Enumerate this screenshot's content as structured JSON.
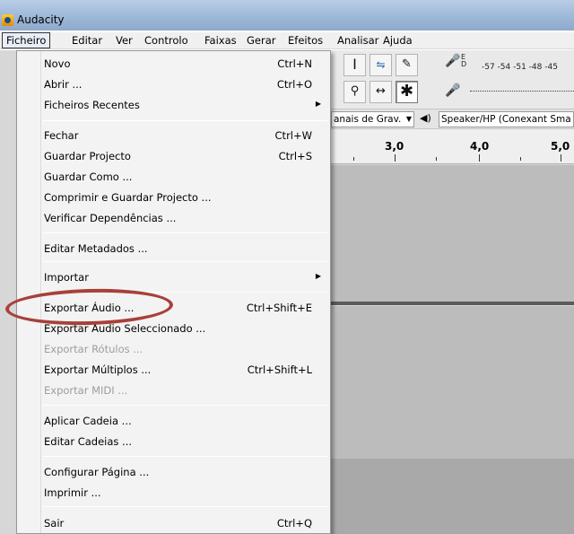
{
  "window": {
    "title": "Audacity"
  },
  "menubar": {
    "items": [
      {
        "name": "menu-ficheiro",
        "label": "Ficheiro",
        "active": true
      },
      {
        "name": "menu-editar",
        "label": "Editar"
      },
      {
        "name": "menu-ver",
        "label": "Ver"
      },
      {
        "name": "menu-controlo",
        "label": "Controlo"
      },
      {
        "name": "menu-faixas",
        "label": "Faixas"
      },
      {
        "name": "menu-gerar",
        "label": "Gerar"
      },
      {
        "name": "menu-efeitos",
        "label": "Efeitos"
      },
      {
        "name": "menu-analisar",
        "label": "Analisar"
      },
      {
        "name": "menu-ajuda",
        "label": "Ajuda"
      }
    ]
  },
  "file_menu": {
    "items": [
      {
        "label": "Novo",
        "shortcut": "Ctrl+N"
      },
      {
        "label": "Abrir ...",
        "shortcut": "Ctrl+O"
      },
      {
        "label": "Ficheiros Recentes",
        "submenu": true
      },
      {
        "separator": true
      },
      {
        "label": "Fechar",
        "shortcut": "Ctrl+W"
      },
      {
        "label": "Guardar Projecto",
        "shortcut": "Ctrl+S"
      },
      {
        "label": "Guardar Como ..."
      },
      {
        "label": "Comprimir e Guardar Projecto ..."
      },
      {
        "label": "Verificar Dependências ..."
      },
      {
        "separator": true
      },
      {
        "label": "Editar Metadados ..."
      },
      {
        "separator": true
      },
      {
        "label": "Importar",
        "submenu": true
      },
      {
        "separator": true
      },
      {
        "label": "Exportar Áudio ...",
        "shortcut": "Ctrl+Shift+E",
        "circled": true
      },
      {
        "label": "Exportar Áudio Seleccionado ..."
      },
      {
        "label": "Exportar Rótulos ...",
        "disabled": true
      },
      {
        "label": "Exportar Múltiplos ...",
        "shortcut": "Ctrl+Shift+L"
      },
      {
        "label": "Exportar MIDI ...",
        "disabled": true
      },
      {
        "separator": true
      },
      {
        "label": "Aplicar Cadeia ..."
      },
      {
        "label": "Editar Cadeias ..."
      },
      {
        "separator": true
      },
      {
        "label": "Configurar Página ..."
      },
      {
        "label": "Imprimir ..."
      },
      {
        "separator": true
      },
      {
        "label": "Sair",
        "shortcut": "Ctrl+Q"
      }
    ]
  },
  "toolbar": {
    "tools": [
      "selection-tool",
      "envelope-tool",
      "draw-tool",
      "zoom-tool",
      "timeshift-tool",
      "multi-tool"
    ],
    "meter_scale": "-57 -54 -51 -48 -45",
    "meter_ed": "E\nD"
  },
  "devicebar": {
    "recording_channels": "anais de Grav.",
    "playback_device": "Speaker/HP (Conexant Sma"
  },
  "ruler": {
    "labels": [
      "3,0",
      "4,0",
      "5,0"
    ]
  },
  "colors": {
    "circle": "#a8403a",
    "menu_bg": "#f3f3f3",
    "track_bg": "#bcbcbc"
  }
}
